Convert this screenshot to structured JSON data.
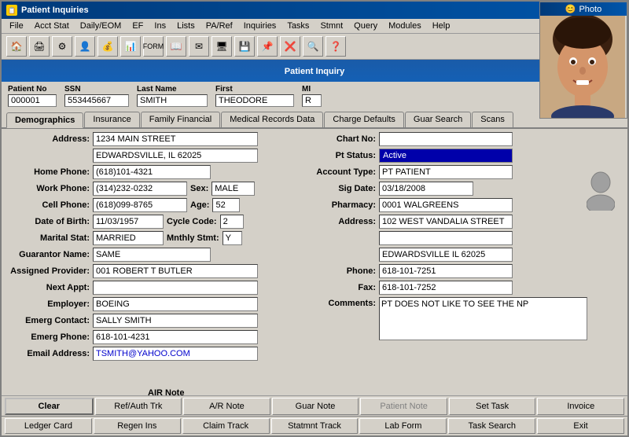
{
  "window": {
    "title": "Patient Inquiries"
  },
  "menu": {
    "items": [
      "File",
      "Acct Stat",
      "Daily/EOM",
      "EF",
      "Ins",
      "Lists",
      "PA/Ref",
      "Inquiries",
      "Tasks",
      "Stmnt",
      "Query",
      "Modules",
      "Help"
    ]
  },
  "toolbar": {
    "icons": [
      "🏠",
      "🖨",
      "⚙",
      "👤",
      "💰",
      "📊",
      "📋",
      "📖",
      "✉",
      "🖥",
      "💾",
      "📌",
      "❌",
      "🔍",
      "❓"
    ]
  },
  "header": {
    "title": "Patient Inquiry"
  },
  "patient_fields": {
    "patient_no_label": "Patient No",
    "patient_no": "000001",
    "ssn_label": "SSN",
    "ssn": "553445667",
    "last_name_label": "Last Name",
    "last_name": "SMITH",
    "first_label": "First",
    "first": "THEODORE",
    "mi_label": "MI",
    "mi": "R"
  },
  "tabs": {
    "items": [
      "Demographics",
      "Insurance",
      "Family Financial",
      "Medical Records Data",
      "Charge Defaults",
      "Guar Search",
      "Scans"
    ],
    "active": "Demographics"
  },
  "demographics": {
    "address_label": "Address:",
    "address1": "1234 MAIN STREET",
    "address2": "EDWARDSVILLE, IL 62025",
    "home_phone_label": "Home Phone:",
    "home_phone": "(618)101-4321",
    "work_phone_label": "Work Phone:",
    "work_phone": "(314)232-0232",
    "sex_label": "Sex:",
    "sex": "MALE",
    "cell_phone_label": "Cell Phone:",
    "cell_phone": "(618)099-8765",
    "age_label": "Age:",
    "age": "52",
    "dob_label": "Date of Birth:",
    "dob": "11/03/1957",
    "cycle_code_label": "Cycle Code:",
    "cycle_code": "2",
    "marital_stat_label": "Marital Stat:",
    "marital_stat": "MARRIED",
    "mnthly_stmt_label": "Mnthly Stmt:",
    "mnthly_stmt": "Y",
    "guarantor_name_label": "Guarantor Name:",
    "guarantor_name": "SAME",
    "assigned_provider_label": "Assigned Provider:",
    "assigned_provider": "001 ROBERT T BUTLER",
    "next_appt_label": "Next Appt:",
    "next_appt": "",
    "employer_label": "Employer:",
    "employer": "BOEING",
    "emerg_contact_label": "Emerg Contact:",
    "emerg_contact": "SALLY SMITH",
    "emerg_phone_label": "Emerg Phone:",
    "emerg_phone": "618-101-4231",
    "email_label": "Email Address:",
    "email": "TSMITH@YAHOO.COM"
  },
  "right_panel": {
    "chart_no_label": "Chart No:",
    "chart_no": "",
    "pt_status_label": "Pt Status:",
    "pt_status": "Active",
    "account_type_label": "Account Type:",
    "account_type": "PT PATIENT",
    "sig_date_label": "Sig Date:",
    "sig_date": "03/18/2008",
    "pharmacy_label": "Pharmacy:",
    "pharmacy": "0001 WALGREENS",
    "address_label": "Address:",
    "address1": "102 WEST VANDALIA STREET",
    "address2": "",
    "address3": "EDWARDSVILLE IL 62025",
    "phone_label": "Phone:",
    "phone": "618-101-7251",
    "fax_label": "Fax:",
    "fax": "618-101-7252",
    "comments_label": "Comments:",
    "comments": "PT DOES NOT LIKE TO SEE THE NP"
  },
  "bottom_row1": {
    "clear": "Clear",
    "ref_auth_trk": "Ref/Auth Trk",
    "ar_note": "A/R Note",
    "guar_note": "Guar Note",
    "patient_note": "Patient Note",
    "set_task": "Set Task",
    "invoice": "Invoice"
  },
  "bottom_row2": {
    "ledger_card": "Ledger Card",
    "regen_ins": "Regen Ins",
    "claim_track": "Claim Track",
    "statmnt_track": "Statmnt Track",
    "lab_form": "Lab Form",
    "task_search": "Task Search",
    "exit": "Exit"
  },
  "photo": {
    "title": "Photo",
    "emoji": "😊"
  },
  "air_note_label": "AIR Note"
}
